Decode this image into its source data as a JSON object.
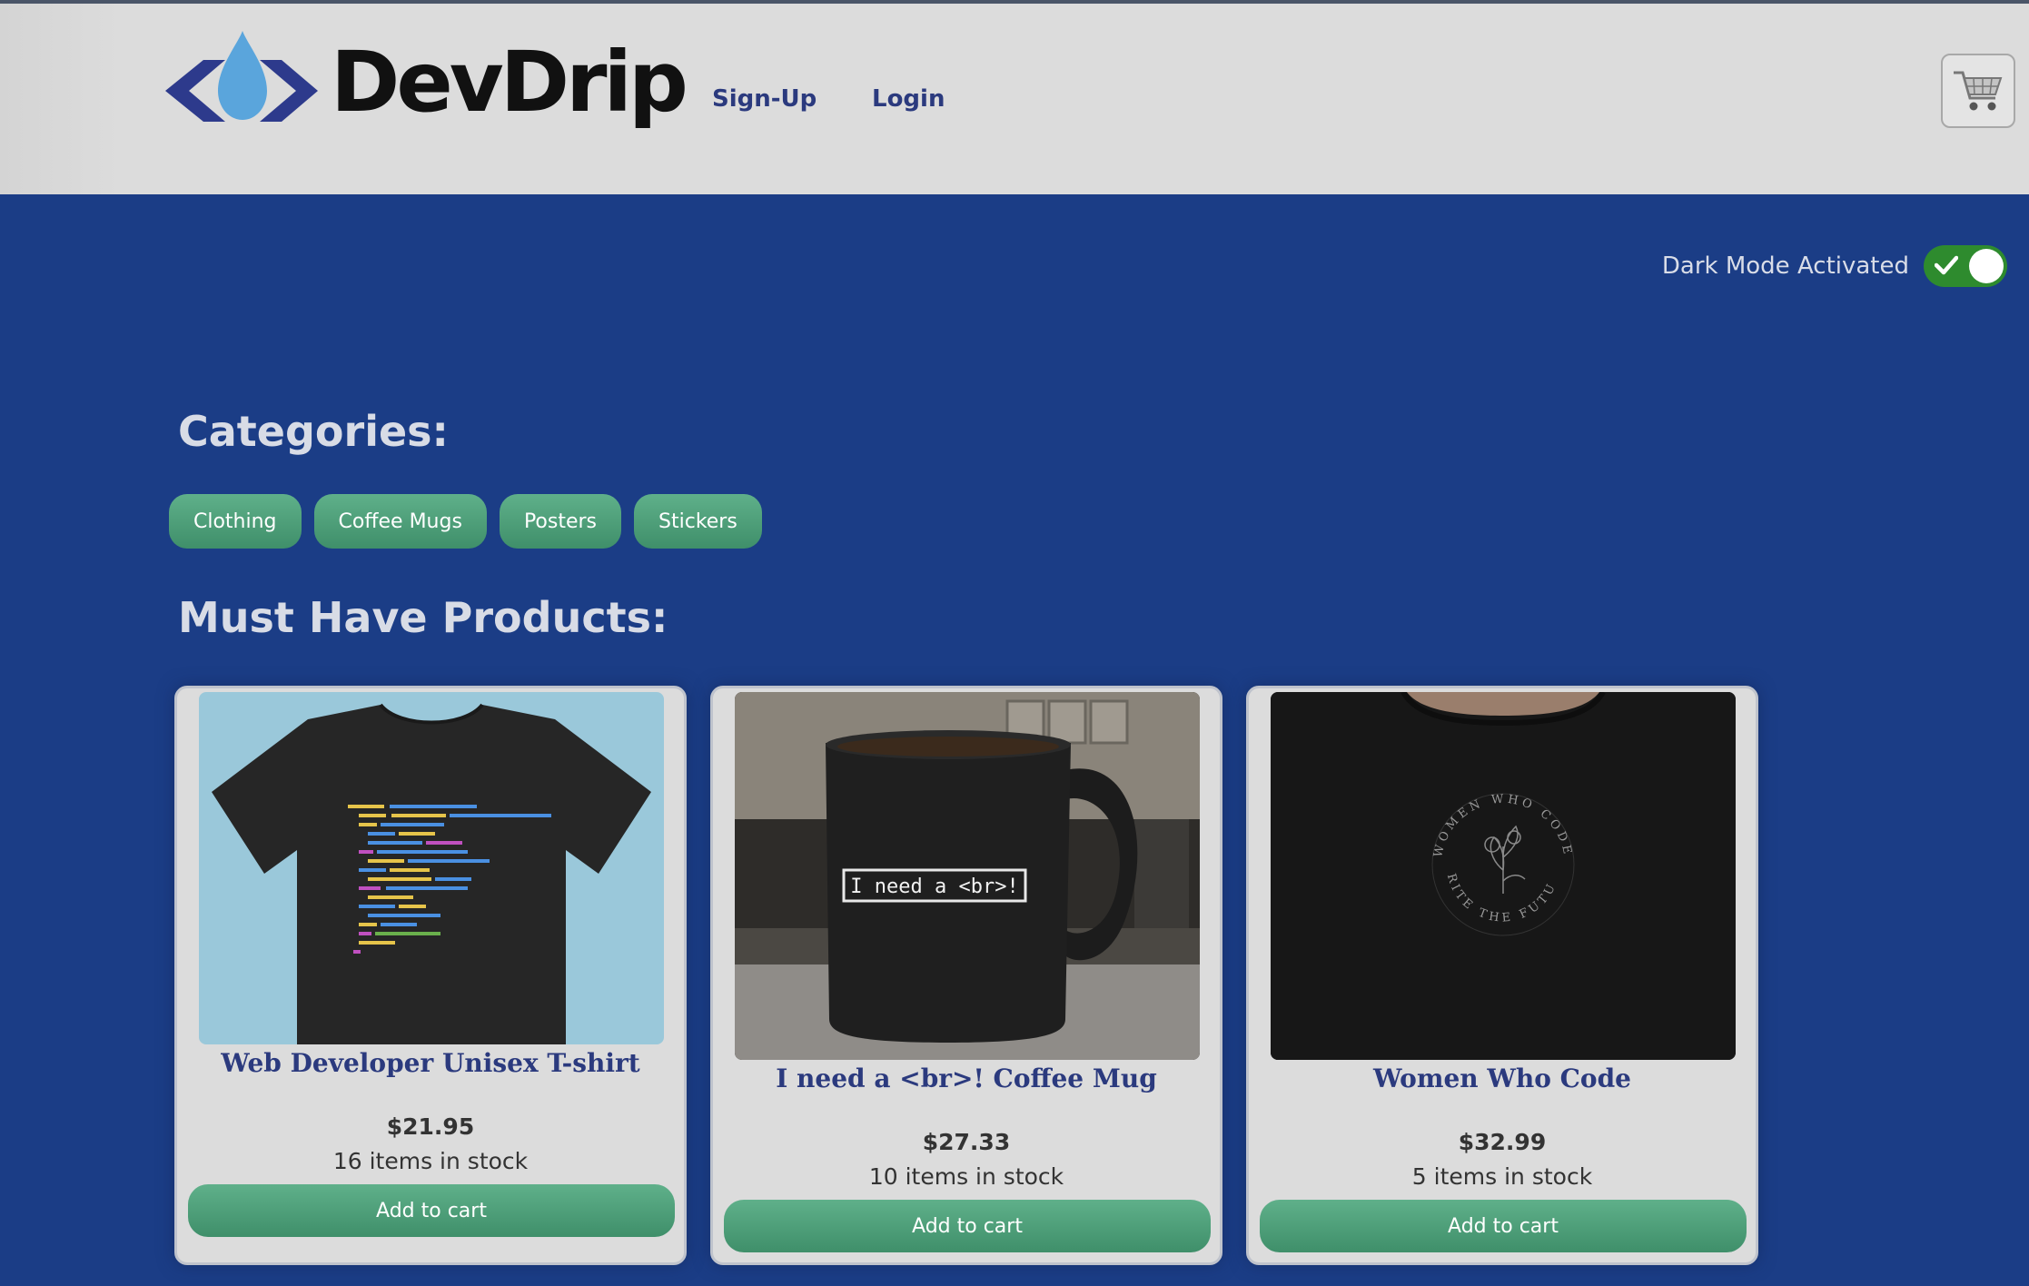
{
  "header": {
    "brand": "DevDrip",
    "nav": {
      "signup": "Sign-Up",
      "login": "Login"
    },
    "cart_icon": "shopping-cart-icon"
  },
  "darkmode": {
    "label": "Dark Mode Activated",
    "enabled": true
  },
  "categories": {
    "title": "Categories:",
    "items": [
      "Clothing",
      "Coffee Mugs",
      "Posters",
      "Stickers"
    ]
  },
  "products": {
    "title": "Must Have Products:",
    "items": [
      {
        "name": "Web Developer Unisex T-shirt",
        "price": "$21.95",
        "stock": "16 items in stock",
        "button": "Add to cart"
      },
      {
        "name": "I need a <br>! Coffee Mug",
        "price": "$27.33",
        "stock": "10 items in stock",
        "button": "Add to cart",
        "mug_text": "I need a <br>!"
      },
      {
        "name": "Women Who Code",
        "price": "$32.99",
        "stock": "5 items in stock",
        "button": "Add to cart",
        "print_top": "WOMEN WHO CODE",
        "print_bottom": "WRITE THE FUTURE"
      }
    ]
  },
  "colors": {
    "background": "#1b3d86",
    "header": "#dcdcdc",
    "accent_green": "#4a9e78",
    "title_blue": "#2b3a7e",
    "logo_blue": "#2d3a8c",
    "drop_blue": "#5aa5dc",
    "toggle_on": "#2e8b2e"
  }
}
